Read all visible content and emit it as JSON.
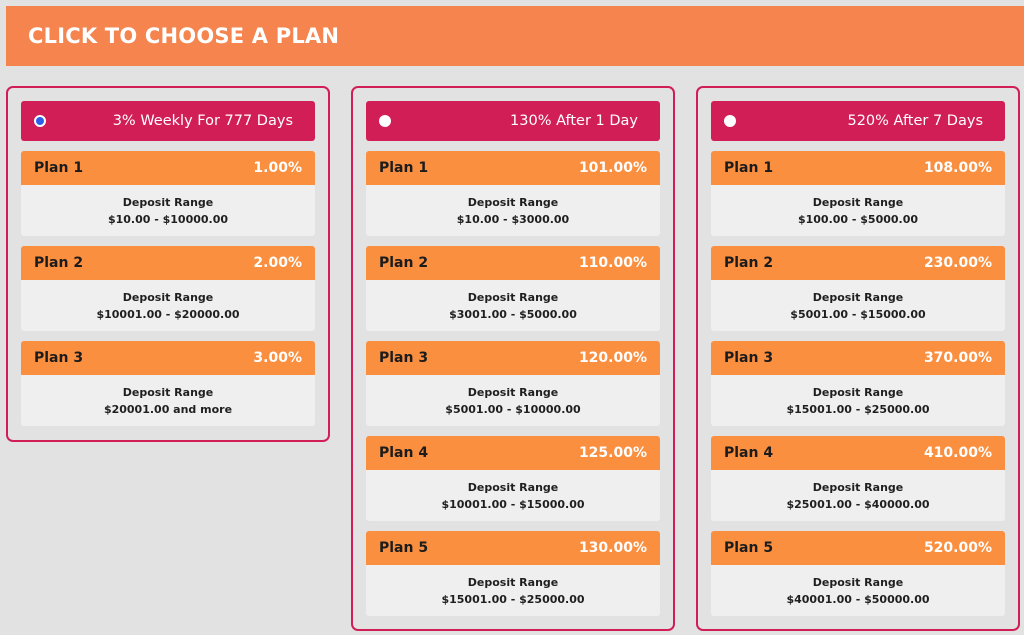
{
  "header": {
    "title": "CLICK TO CHOOSE A PLAN"
  },
  "columns": [
    {
      "title": "3% Weekly For 777 Days",
      "selected": true,
      "plans": [
        {
          "name": "Plan 1",
          "percent": "1.00%",
          "range_label": "Deposit Range",
          "range": "$10.00 - $10000.00"
        },
        {
          "name": "Plan 2",
          "percent": "2.00%",
          "range_label": "Deposit Range",
          "range": "$10001.00 - $20000.00"
        },
        {
          "name": "Plan 3",
          "percent": "3.00%",
          "range_label": "Deposit Range",
          "range": "$20001.00 and more"
        }
      ]
    },
    {
      "title": "130% After 1 Day",
      "selected": false,
      "plans": [
        {
          "name": "Plan 1",
          "percent": "101.00%",
          "range_label": "Deposit Range",
          "range": "$10.00 - $3000.00"
        },
        {
          "name": "Plan 2",
          "percent": "110.00%",
          "range_label": "Deposit Range",
          "range": "$3001.00 - $5000.00"
        },
        {
          "name": "Plan 3",
          "percent": "120.00%",
          "range_label": "Deposit Range",
          "range": "$5001.00 - $10000.00"
        },
        {
          "name": "Plan 4",
          "percent": "125.00%",
          "range_label": "Deposit Range",
          "range": "$10001.00 - $15000.00"
        },
        {
          "name": "Plan 5",
          "percent": "130.00%",
          "range_label": "Deposit Range",
          "range": "$15001.00 - $25000.00"
        }
      ]
    },
    {
      "title": "520% After 7 Days",
      "selected": false,
      "plans": [
        {
          "name": "Plan 1",
          "percent": "108.00%",
          "range_label": "Deposit Range",
          "range": "$100.00 - $5000.00"
        },
        {
          "name": "Plan 2",
          "percent": "230.00%",
          "range_label": "Deposit Range",
          "range": "$5001.00 - $15000.00"
        },
        {
          "name": "Plan 3",
          "percent": "370.00%",
          "range_label": "Deposit Range",
          "range": "$15001.00 - $25000.00"
        },
        {
          "name": "Plan 4",
          "percent": "410.00%",
          "range_label": "Deposit Range",
          "range": "$25001.00 - $40000.00"
        },
        {
          "name": "Plan 5",
          "percent": "520.00%",
          "range_label": "Deposit Range",
          "range": "$40001.00 - $50000.00"
        }
      ]
    }
  ],
  "colors": {
    "header": "#f5844f",
    "accent": "#d11e57",
    "plan_bar": "#fa8f40",
    "radio_selected": "#2f5ee8"
  }
}
